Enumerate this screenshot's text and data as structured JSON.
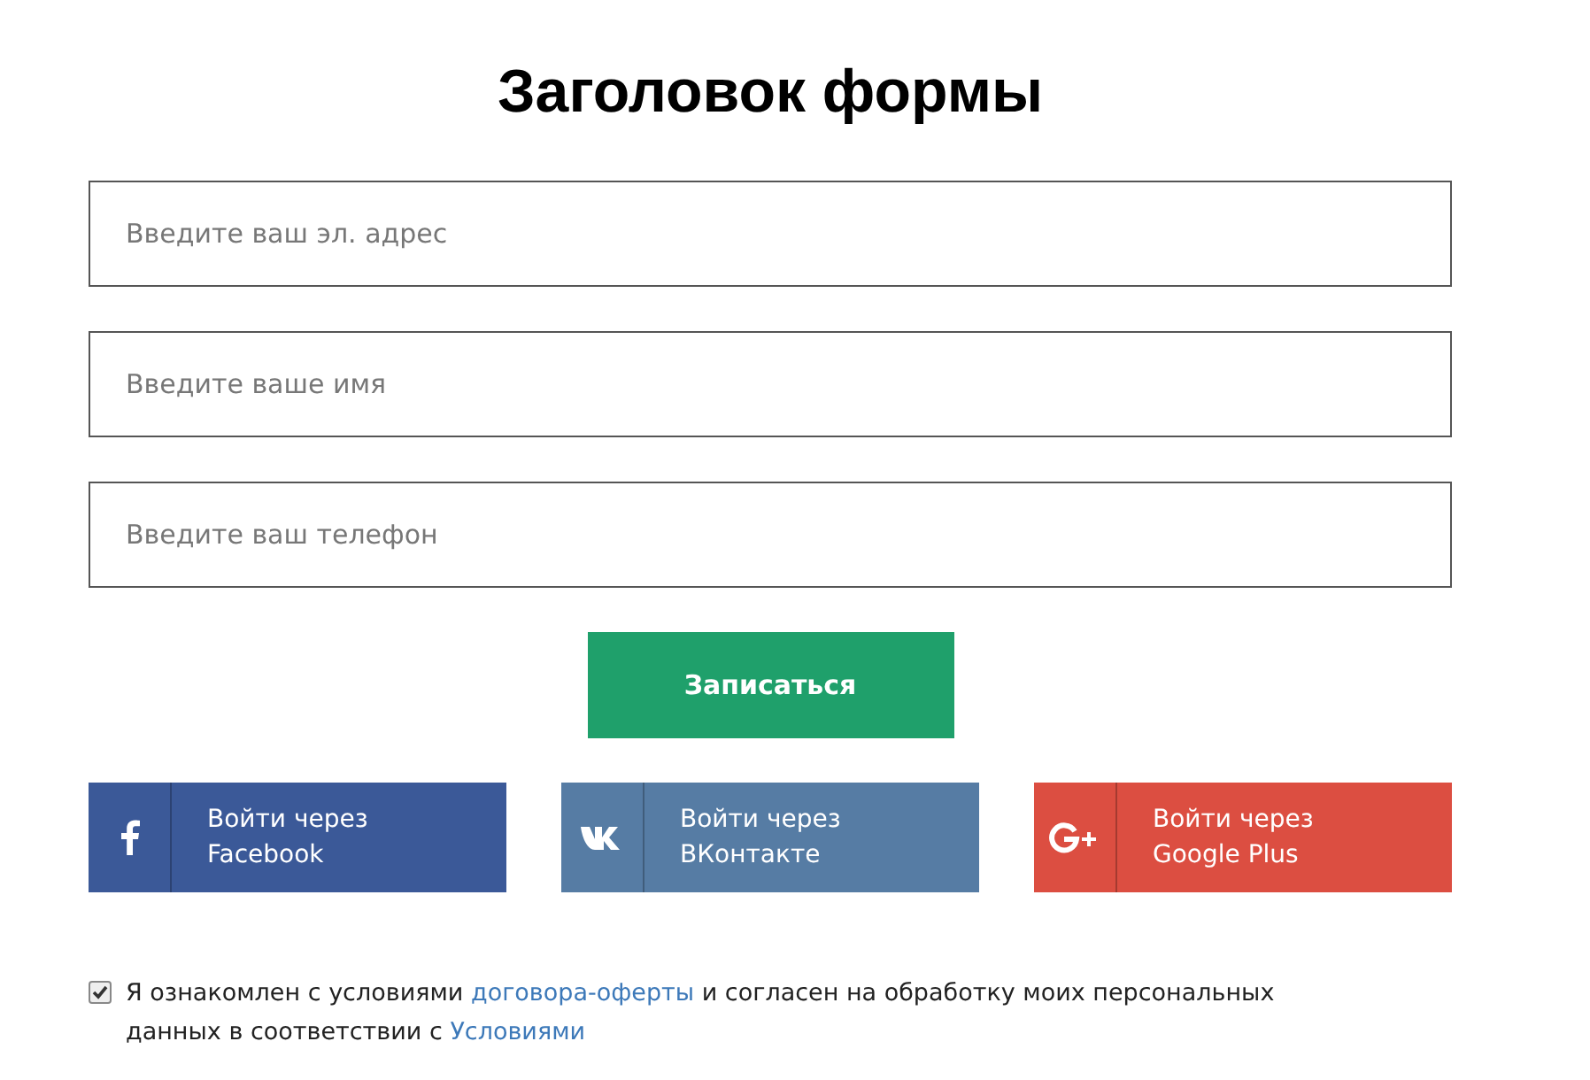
{
  "title": "Заголовок формы",
  "fields": [
    {
      "placeholder": "Введите ваш эл. адрес"
    },
    {
      "placeholder": "Введите ваше имя"
    },
    {
      "placeholder": "Введите ваш телефон"
    }
  ],
  "submit": "Записаться",
  "social": [
    {
      "kind": "facebook",
      "color": "#3b5998",
      "lines": [
        "Войти через",
        "Facebook"
      ]
    },
    {
      "kind": "vk",
      "color": "#567ca4",
      "lines": [
        "Войти через",
        "ВКонтакте"
      ]
    },
    {
      "kind": "google",
      "color": "#dc4e41",
      "lines": [
        "Войти через",
        "Google Plus"
      ]
    }
  ],
  "consent": {
    "checked": true,
    "parts": [
      {
        "kind": "text",
        "text": "Я ознакомлен с условиями "
      },
      {
        "kind": "link",
        "text": "договора-оферты"
      },
      {
        "kind": "text",
        "text": " и согласен на обработку моих персональных данных в соответствии с "
      },
      {
        "kind": "link",
        "text": "Условиями"
      }
    ]
  }
}
